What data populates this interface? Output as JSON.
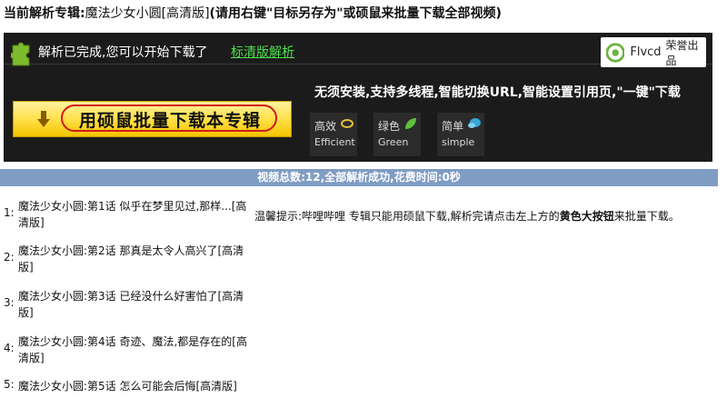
{
  "header": {
    "label": "当前解析专辑:",
    "album": "魔法少女小圆[高清版]",
    "note": "(请用右键\"目标另存为\"或硕鼠来批量下载全部视频)"
  },
  "banner": {
    "status_text": "解析已完成,您可以开始下载了",
    "standard_link": "标清版解析",
    "logo_name": "Flvcd",
    "logo_tag": "荣誉出品",
    "feature_text": "无须安装,支持多线程,智能切换URL,智能设置引用页,\"一键\"下载",
    "big_button_label": "用硕鼠批量下载本专辑",
    "tiles": [
      {
        "cn": "高效",
        "en": "Efficient"
      },
      {
        "cn": "绿色",
        "en": "Green"
      },
      {
        "cn": "简单",
        "en": "simple"
      }
    ],
    "colors": {
      "background": "#1b1b1b",
      "link": "#4fe04f",
      "button": "#ffe14a",
      "oval": "#d21a1a"
    }
  },
  "stats": {
    "text": "视频总数:12,全部解析成功,花费时间:0秒",
    "bar_color": "#7f9cc3"
  },
  "videos": [
    {
      "num": "1:",
      "title": "魔法少女小圆:第1话 似乎在梦里见过,那样...[高清版]"
    },
    {
      "num": "2:",
      "title": "魔法少女小圆:第2话 那真是太令人高兴了[高清版]"
    },
    {
      "num": "3:",
      "title": "魔法少女小圆:第3话 已经没什么好害怕了[高清版]"
    },
    {
      "num": "4:",
      "title": "魔法少女小圆:第4话 奇迹、魔法,都是存在的[高清版]"
    },
    {
      "num": "5:",
      "title": "魔法少女小圆:第5话 怎么可能会后悔[高清版]"
    }
  ],
  "tip": {
    "prefix": "温馨提示:哔哩哔哩 专辑只能用硕鼠下载,解析完请点击左上方的",
    "bold": "黄色大按钮",
    "suffix": "来批量下载。"
  }
}
